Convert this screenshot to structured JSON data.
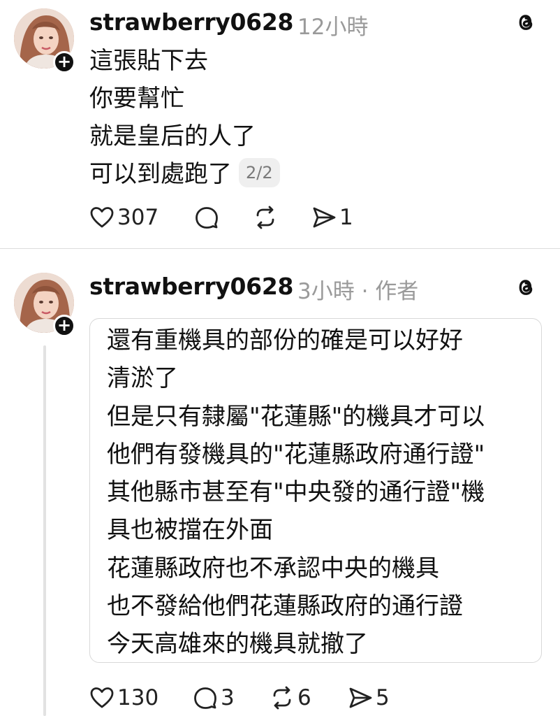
{
  "posts": [
    {
      "username": "strawberry0628",
      "meta": "12小時",
      "lines": [
        "這張貼下去",
        "你要幫忙",
        "就是皇后的人了",
        "可以到處跑了"
      ],
      "page_indicator": "2/2",
      "stats": {
        "likes": "307",
        "comments": "",
        "reposts": "",
        "shares": "1"
      }
    },
    {
      "username": "strawberry0628",
      "meta": "3小時 · 作者",
      "quote_lines": [
        "還有重機具的部份的確是可以好好",
        "清淤了",
        "但是只有隸屬\"花蓮縣\"的機具才可以",
        "他們有發機具的\"花蓮縣政府通行證\"",
        "其他縣市甚至有\"中央發的通行證\"機",
        "具也被擋在外面",
        "花蓮縣政府也不承認中央的機具",
        "也不發給他們花蓮縣政府的通行證",
        "今天高雄來的機具就撤了"
      ],
      "stats": {
        "likes": "130",
        "comments": "3",
        "reposts": "6",
        "shares": "5"
      }
    }
  ],
  "icons": {
    "like": "heart-icon",
    "comment": "comment-bubble-icon",
    "repost": "repost-icon",
    "share": "send-icon",
    "logo": "threads-logo-icon",
    "follow": "plus-icon"
  }
}
